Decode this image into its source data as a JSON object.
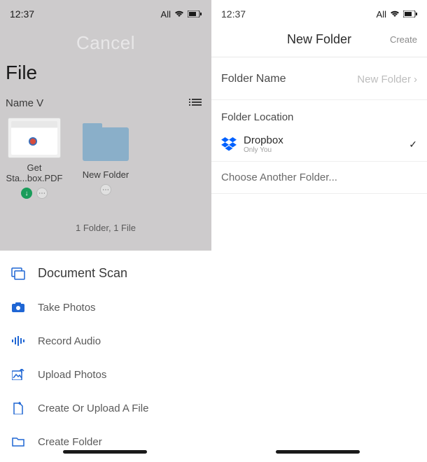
{
  "left": {
    "time": "12:37",
    "carrier": "All",
    "cancel": "Cancel",
    "title": "File",
    "sort_label": "Name V",
    "files": [
      {
        "name": "Get Sta...box.PDF"
      },
      {
        "name": "New Folder"
      }
    ],
    "summary": "1 Folder, 1 File"
  },
  "right": {
    "time": "12:37",
    "carrier": "All",
    "title": "New Folder",
    "create_label": "Create",
    "folder_name_label": "Folder Name",
    "folder_name_value": "New Folder",
    "location_label": "Folder Location",
    "location": {
      "name": "Dropbox",
      "sub": "Only You"
    },
    "choose_label": "Choose Another Folder..."
  },
  "actions": [
    {
      "label": "Document Scan",
      "icon": "scan"
    },
    {
      "label": "Take Photos",
      "icon": "camera"
    },
    {
      "label": "Record Audio",
      "icon": "audio"
    },
    {
      "label": "Upload Photos",
      "icon": "upload-photo"
    },
    {
      "label": "Create Or Upload A File",
      "icon": "create-file"
    },
    {
      "label": "Create Folder",
      "icon": "folder"
    }
  ]
}
